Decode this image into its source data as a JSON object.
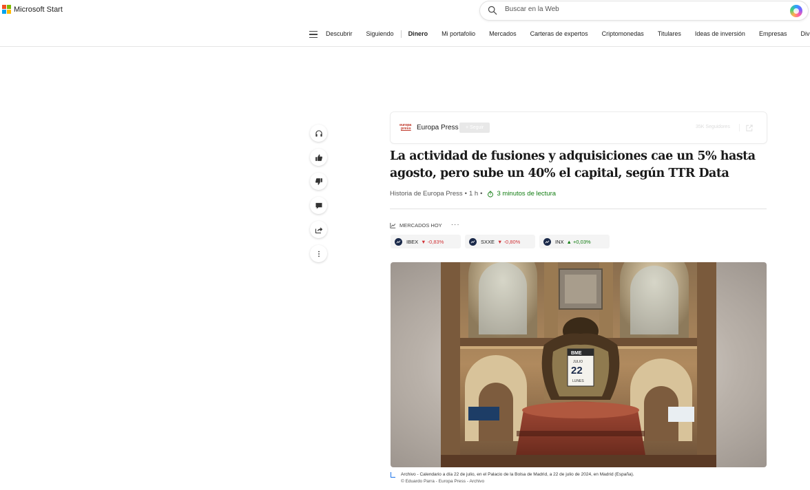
{
  "header": {
    "brand": "Microsoft Start",
    "search_placeholder": "Buscar en la Web"
  },
  "nav": {
    "items": [
      {
        "label": "Descubrir",
        "active": false
      },
      {
        "label": "Siguiendo",
        "active": false
      },
      {
        "label": "Dinero",
        "active": true
      },
      {
        "label": "Mi portafolio",
        "active": false
      },
      {
        "label": "Mercados",
        "active": false
      },
      {
        "label": "Carteras de expertos",
        "active": false
      },
      {
        "label": "Criptomonedas",
        "active": false
      },
      {
        "label": "Titulares",
        "active": false
      },
      {
        "label": "Ideas de inversión",
        "active": false
      },
      {
        "label": "Empresas",
        "active": false
      },
      {
        "label": "Divisas",
        "active": false
      }
    ]
  },
  "rail": {
    "icons": [
      "headphones-icon",
      "thumbs-up-icon",
      "thumbs-down-icon",
      "comment-icon",
      "share-icon",
      "more-vertical-icon"
    ]
  },
  "publisher": {
    "logo_line1": "europa",
    "logo_line2": "press",
    "name": "Europa Press",
    "follow_label": "+ Seguir",
    "followers": "35K Seguidores"
  },
  "article": {
    "title": "La actividad de fusiones y adquisiciones cae un 5% hasta agosto, pero sube un 40% el capital, según TTR Data",
    "source": "Historia de Europa Press",
    "time": "1 h",
    "read_time": "3 minutos de lectura"
  },
  "markets": {
    "heading": "MERCADOS HOY",
    "tickers": [
      {
        "symbol": "IBEX",
        "change": "-0,83%",
        "direction": "down"
      },
      {
        "symbol": "SXXE",
        "change": "-0,80%",
        "direction": "down"
      },
      {
        "symbol": "INX",
        "change": "+0,03%",
        "direction": "up"
      }
    ]
  },
  "image": {
    "sign_label": "BME",
    "month": "JULIO",
    "day": "22",
    "weekday": "LUNES"
  },
  "caption": {
    "text": "Archivo - Calendario a día 22 de julio, en el Palacio de la Bolsa de Madrid, a 22 de julio de 2024, en Madrid (España).",
    "credit": "© Eduardo Parra - Europa Press - Archivo"
  },
  "colors": {
    "accent_green": "#107c10",
    "down_red": "#d13438",
    "ticker_badge": "#1b2a4a"
  }
}
